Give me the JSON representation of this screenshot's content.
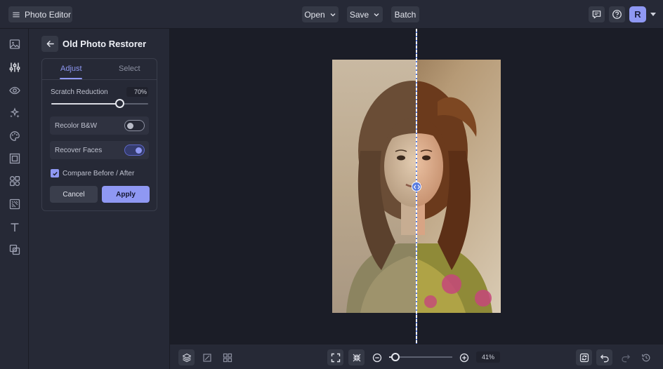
{
  "header": {
    "app_title": "Photo Editor",
    "menus": [
      {
        "label": "Open"
      },
      {
        "label": "Save"
      },
      {
        "label": "Batch"
      }
    ],
    "avatar_initial": "R"
  },
  "panel": {
    "title": "Old Photo Restorer",
    "tabs": [
      {
        "label": "Adjust",
        "active": true
      },
      {
        "label": "Select",
        "active": false
      }
    ],
    "scratch_reduction": {
      "label": "Scratch Reduction",
      "value_text": "70%",
      "value": 70,
      "max": 100
    },
    "recolor_bw": {
      "label": "Recolor B&W",
      "on": false
    },
    "recover_faces": {
      "label": "Recover Faces",
      "on": true
    },
    "compare": {
      "label": "Compare Before / After",
      "checked": true
    },
    "cancel_label": "Cancel",
    "apply_label": "Apply"
  },
  "zoom": {
    "value_text": "41%",
    "level": 0.1
  },
  "compare_split": 0.5,
  "colors": {
    "accent": "#8f98f3",
    "compare_line": "#5b7de0",
    "surface": "#262936",
    "background": "#1b1d27"
  },
  "icons": {
    "menu": "hamburger-icon",
    "comment": "comment-icon",
    "help": "help-icon",
    "rail": [
      "image-icon",
      "sliders-icon",
      "eye-icon",
      "sparkle-icon",
      "palette-icon",
      "frame-icon",
      "shapes-icon",
      "texture-icon",
      "text-icon",
      "overlay-icon"
    ]
  }
}
